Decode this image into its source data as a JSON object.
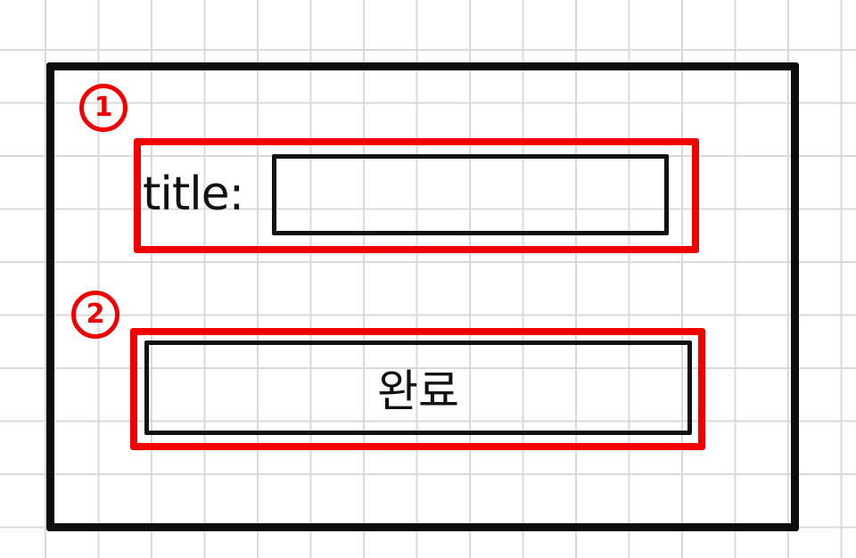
{
  "markers": {
    "first": "1",
    "second": "2"
  },
  "title_field": {
    "label": "title:",
    "value": ""
  },
  "done_button": {
    "label": "완료"
  }
}
